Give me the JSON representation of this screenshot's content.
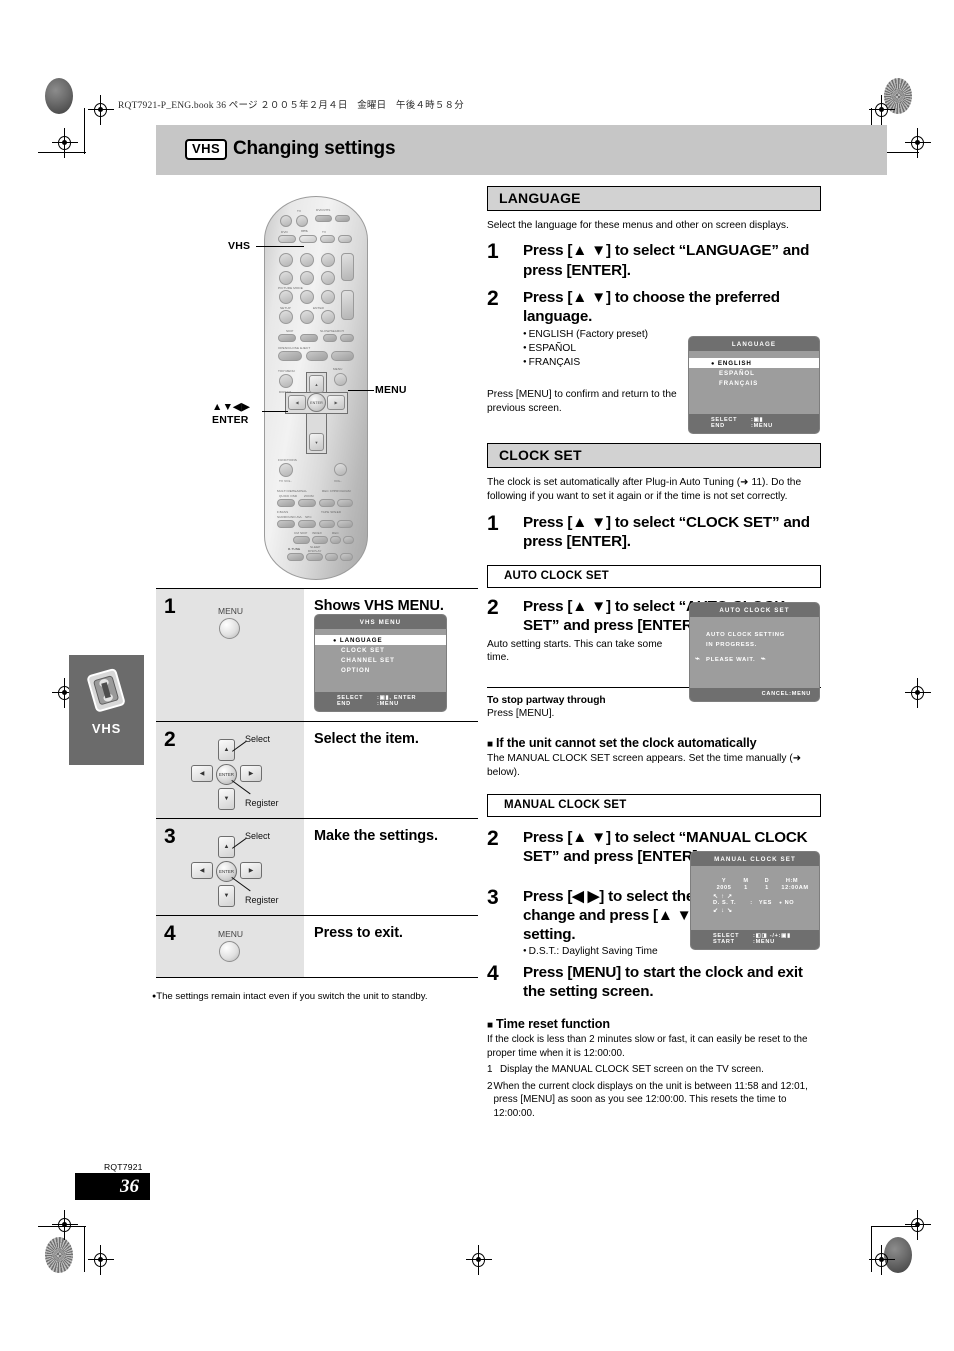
{
  "header": {
    "book_line": "RQT7921-P_ENG.book  36 ページ  ２００５年２月４日　金曜日　午後４時５８分",
    "badge": "VHS",
    "title": "Changing settings"
  },
  "side_tab": {
    "label": "VHS"
  },
  "remote": {
    "callouts": {
      "vhs": "VHS",
      "menu": "MENU",
      "dpad_line1": "▲▼◀▶",
      "dpad_line2": "ENTER"
    },
    "keys": {
      "tv": "TV",
      "dvd": "DVD",
      "vhs": "VHS",
      "tv2": "TV",
      "dvd_vhs": "DVD/VHS",
      "picture_mode": "PICTURE MODE",
      "setup": "SETUP",
      "enter": "ENTER",
      "skip": "SKIP",
      "slow_search": "SLOW/SEARCH",
      "open_close_eject": "OPEN/CLOSE EJECT",
      "top_menu": "TOP MENU",
      "direct": "DIRECT",
      "menu": "MENU",
      "functions": "FUNCTIONS",
      "tv_vol": "TV VOL-",
      "vol": "VOL-",
      "zoom": "ZOOM",
      "quick_osd": "QUICK OSD",
      "multi_rehearsal": "MULTI REHEARSAL",
      "tape_speed": "TAPE SPEED",
      "ch": "CH",
      "program": "PROGRAM",
      "f_bass": "F.BASS",
      "surround": "SURROUND",
      "cm_skip": "CM SKIP",
      "index": "INDEX",
      "rec": "REC",
      "sleep": "SLEEP",
      "display": "DISPLAY",
      "enter_dpad": "ENTER"
    }
  },
  "procedure": {
    "rows": [
      {
        "num": "1",
        "icon": "menu-button",
        "icon_label": "MENU",
        "text": "Shows VHS MENU.",
        "has_osd": true
      },
      {
        "num": "2",
        "icon": "dpad",
        "select_label": "Select",
        "register_label": "Register",
        "text": "Select the item."
      },
      {
        "num": "3",
        "icon": "dpad",
        "select_label": "Select",
        "register_label": "Register",
        "text": "Make the settings."
      },
      {
        "num": "4",
        "icon": "menu-button",
        "icon_label": "MENU",
        "text": "Press to exit."
      }
    ],
    "footnote": "The settings remain intact even if you switch the unit to standby."
  },
  "osd_vhs_menu": {
    "title": "VHS MENU",
    "items": [
      "LANGUAGE",
      "CLOCK  SET",
      "CHANNEL SET",
      "OPTION"
    ],
    "selected_index": 0,
    "footer": [
      {
        "key": "SELECT",
        "value": ":▣▮, ENTER"
      },
      {
        "key": "END",
        "value": ":MENU"
      }
    ]
  },
  "osd_language": {
    "title": "LANGUAGE",
    "items": [
      "ENGLISH",
      "ESPAÑOL",
      "FRANÇAIS"
    ],
    "selected_index": 0,
    "footer": [
      {
        "key": "SELECT",
        "value": ":▣▮"
      },
      {
        "key": "END",
        "value": ":MENU"
      }
    ]
  },
  "osd_auto_clock": {
    "title": "AUTO CLOCK SET",
    "line1": "AUTO  CLOCK SETTING",
    "line2": "IN PROGRESS.",
    "wait": "PLEASE  WAIT.",
    "footer": "CANCEL:MENU"
  },
  "osd_manual_clock": {
    "title": "MANUAL  CLOCK  SET",
    "col_headers": [
      "Y",
      "M",
      "D",
      "H:M"
    ],
    "col_values": [
      "2005",
      "1",
      "1",
      "12:00AM"
    ],
    "dst_label": "D. S. T.",
    "dst_sep": ":",
    "dst_yes": "YES",
    "dst_no": "NO",
    "dst_selected": "NO",
    "footer": [
      {
        "key": "SELECT",
        "value": ":◧◨   -/+:▣▮"
      },
      {
        "key": "START",
        "value": ":MENU"
      }
    ]
  },
  "language_section": {
    "heading": "LANGUAGE",
    "intro": "Select the language for these menus and other on screen displays.",
    "steps": [
      {
        "num": "1",
        "text": "Press [▲ ▼] to select “LANGUAGE” and press [ENTER]."
      },
      {
        "num": "2",
        "text": "Press [▲ ▼] to choose the preferred language."
      }
    ],
    "bullets": [
      "ENGLISH (Factory preset)",
      "ESPAÑOL",
      "FRANÇAIS"
    ],
    "note": "Press [MENU] to confirm and return to the previous screen."
  },
  "clock_section": {
    "heading": "CLOCK SET",
    "intro": "The clock is set automatically after Plug-in Auto Tuning (➜ 11). Do the following if you want to set it again or if the time is not set correctly.",
    "step1": {
      "num": "1",
      "text": "Press [▲ ▼] to select “CLOCK SET” and press [ENTER]."
    },
    "subhead_auto": "AUTO CLOCK SET",
    "step2_auto": {
      "num": "2",
      "text": "Press [▲ ▼] to select “AUTO CLOCK SET” and press [ENTER]."
    },
    "auto_note": "Auto setting starts. This can take some time.",
    "stop_head": "To stop partway through",
    "stop_text": "Press [MENU].",
    "cannot_head": "If the unit cannot set the clock automatically",
    "cannot_text": "The MANUAL CLOCK SET screen appears. Set the time manually (➜ below).",
    "subhead_manual": "MANUAL CLOCK SET",
    "step2_manual": {
      "num": "2",
      "text": "Press [▲ ▼] to select “MANUAL CLOCK SET” and press [ENTER]."
    },
    "step3": {
      "num": "3",
      "text": "Press [◀ ▶] to select the item you want to change and press [▲ ▼] to change the setting."
    },
    "step3_bullet": "D.S.T.: Daylight Saving Time",
    "step4": {
      "num": "4",
      "text": "Press [MENU] to start the clock and exit the setting screen."
    },
    "reset_head": "Time reset function",
    "reset_intro": "If the clock is less than 2 minutes slow or fast, it can easily be reset to the proper time when it is 12:00:00.",
    "reset_items": [
      {
        "ix": "1",
        "text": "Display the MANUAL CLOCK SET screen on the TV screen."
      },
      {
        "ix": "2",
        "text": "When the current clock displays on the unit is between 11:58 and 12:01, press [MENU] as soon as you see 12:00:00. This resets the time to 12:00:00."
      }
    ]
  },
  "footer": {
    "rqt": "RQT7921",
    "page": "36"
  },
  "colors": {
    "title_bar": "#c6c6c6",
    "section_head": "#d2d2d2",
    "osd_body": "#9d9d9d",
    "osd_bar": "#6f6f6f",
    "tab": "#6b6b6b"
  }
}
